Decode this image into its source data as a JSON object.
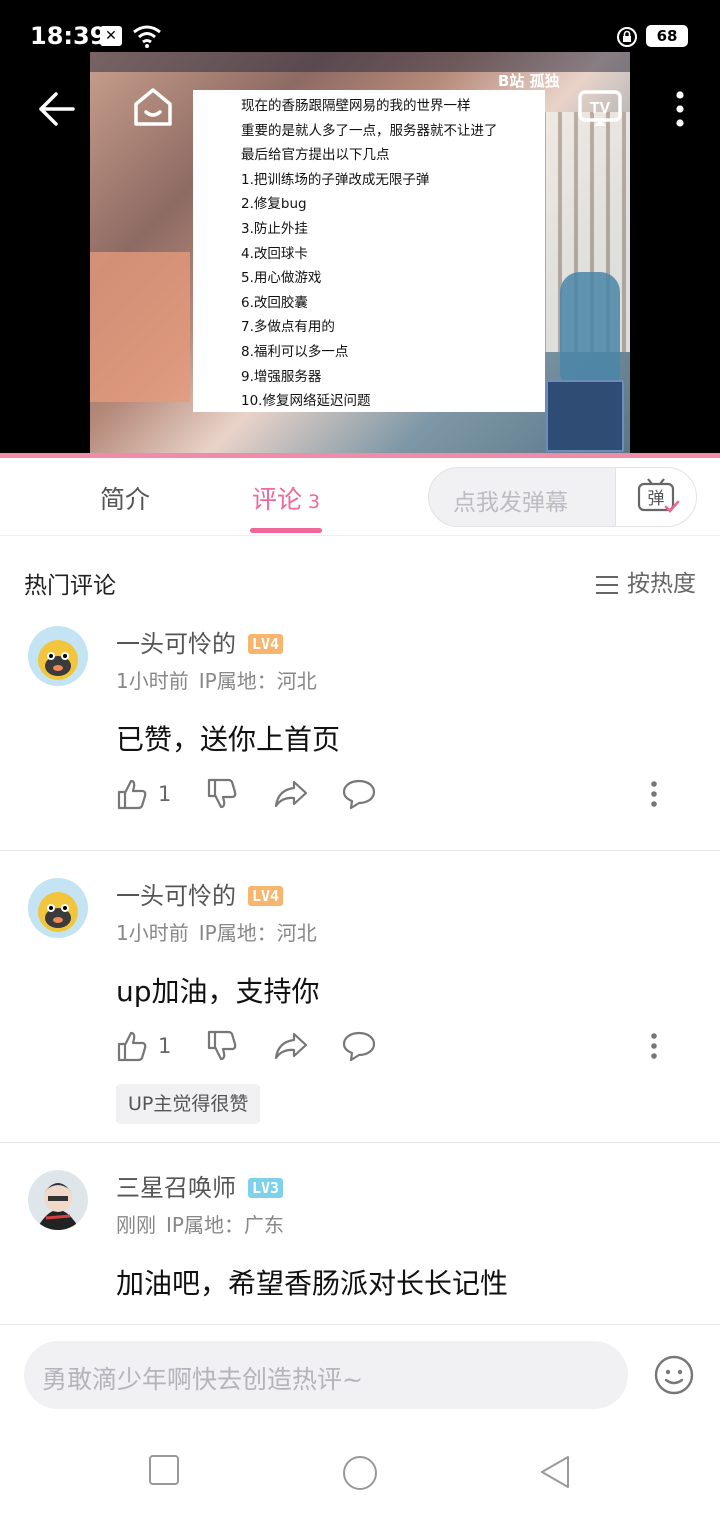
{
  "status_bar": {
    "time": "18:39",
    "battery": "68",
    "icons": [
      "notification-x-icon",
      "wifi-icon",
      "lock-rotation-icon",
      "battery-icon"
    ]
  },
  "video": {
    "watermark": "B站 孤独",
    "note_lines": [
      "现在的香肠跟隔壁网易的我的世界一样",
      "重要的是就人多了一点，服务器就不让进了",
      "最后给官方提出以下几点",
      "1.把训练场的子弹改成无限子弹",
      "2.修复bug",
      "3.防止外挂",
      "4.改回球卡",
      "5.用心做游戏",
      "6.改回胶囊",
      "7.多做点有用的",
      "8.福利可以多一点",
      "9.增强服务器",
      "10.修复网络延迟问题"
    ],
    "controls": [
      "back-icon",
      "home-icon",
      "audio-icon",
      "tv-cast-icon",
      "more-icon"
    ]
  },
  "tabs": {
    "intro": "简介",
    "comments": "评论",
    "comments_count": "3",
    "danmaku_placeholder": "点我发弹幕",
    "danmaku_button": "弹"
  },
  "comments_section": {
    "title": "热门评论",
    "sort_label": "按热度"
  },
  "comments": [
    {
      "user": "一头可怜的",
      "level": "LV4",
      "time": "1小时前",
      "ip": "IP属地：河北",
      "text": "已赞，送你上首页",
      "likes": "1",
      "badge": ""
    },
    {
      "user": "一头可怜的",
      "level": "LV4",
      "time": "1小时前",
      "ip": "IP属地：河北",
      "text": "up加油，支持你",
      "likes": "1",
      "badge": "UP主觉得很赞"
    },
    {
      "user": "三星召唤师",
      "level": "LV3",
      "time": "刚刚",
      "ip": "IP属地：广东",
      "text": "加油吧，希望香肠派对长长记性",
      "likes": "",
      "badge": ""
    }
  ],
  "bottom": {
    "input_placeholder": "勇敢滴少年啊快去创造热评~"
  },
  "colors": {
    "accent_pink": "#f0689a",
    "lv4": "#f7b56e",
    "lv3": "#7fd0ea"
  }
}
